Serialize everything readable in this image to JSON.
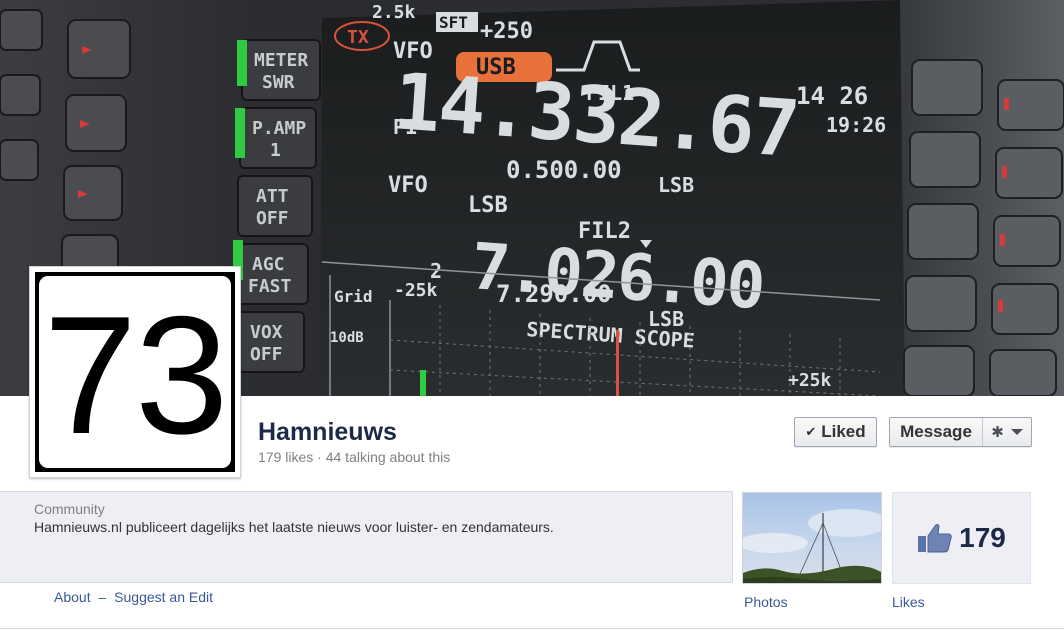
{
  "cover": {
    "display": {
      "tx": "TX",
      "agc_value": "2.5k",
      "sft": "SFT",
      "sft_value": "+250",
      "vfo_a_label": "VFO",
      "mode_a": "USB",
      "fil1": "FIL1",
      "main_frequency": "14.332.67",
      "p1": "P1",
      "offset_a": "0.500.00",
      "mode_a_small": "LSB",
      "time_top": "14 26",
      "time_bottom": "19:26",
      "vfo_b_label": "VFO",
      "mode_b": "LSB",
      "fil2": "FIL2",
      "sub_frequency": "7.026.00",
      "sub_index": "2",
      "offset_b": "7.290.00",
      "mode_b_small": "LSB",
      "scope_left": "-25k",
      "scope_title": "SPECTRUM SCOPE",
      "scope_right": "+25k",
      "grid_label": "Grid",
      "grid_db": "10dB"
    },
    "keys": {
      "meter": [
        "METER",
        "SWR"
      ],
      "pamp": [
        "P.AMP",
        "1"
      ],
      "att": [
        "ATT",
        "OFF"
      ],
      "agc": [
        "AGC",
        "FAST"
      ],
      "vox": [
        "VOX",
        "OFF"
      ]
    }
  },
  "profile": {
    "number": "73"
  },
  "page": {
    "name": "Hamnieuws",
    "likes_text": "179 likes",
    "dot": "·",
    "talking_text": "44 talking about this"
  },
  "actions": {
    "liked_label": "Liked",
    "message_label": "Message"
  },
  "info": {
    "category": "Community",
    "description": "Hamnieuws.nl publiceert dagelijks het laatste nieuws voor luister- en zendamateurs.",
    "about_link": "About",
    "separator": "–",
    "suggest_link": "Suggest an Edit"
  },
  "tiles": {
    "photos_label": "Photos",
    "likes_count": "179",
    "likes_label": "Likes"
  },
  "colors": {
    "page_name": "#1c2a47",
    "link": "#3b5998",
    "info_bg": "#edeff4",
    "display_text": "#d9dde0",
    "usb_badge": "#e8703a",
    "key_led": "#2ecc40"
  }
}
